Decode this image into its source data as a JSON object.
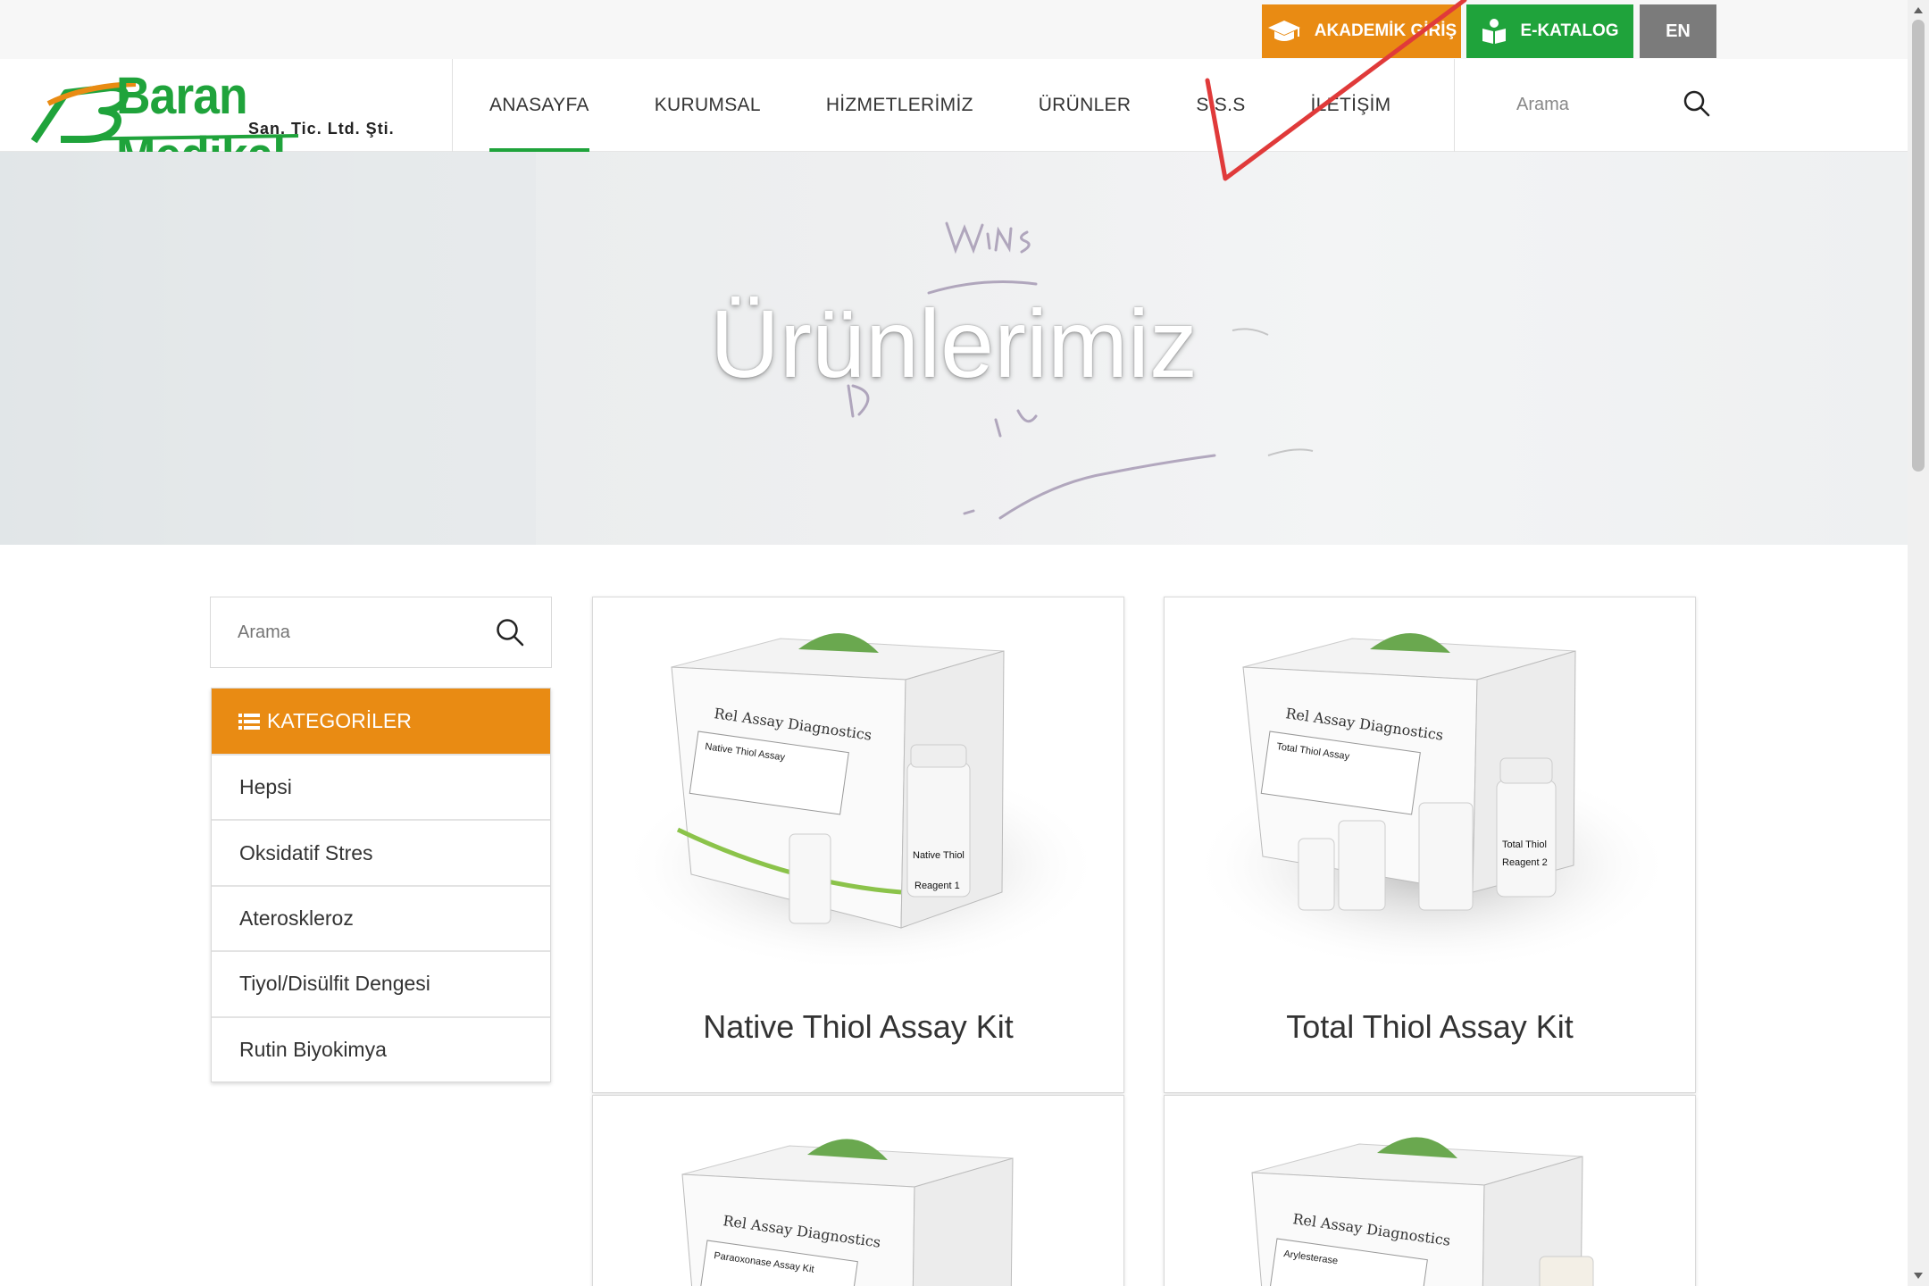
{
  "topbar": {
    "academic_label": "AKADEMİK GİRİŞ",
    "catalog_label": "E-KATALOG",
    "language_label": "EN"
  },
  "header": {
    "logo_name": "Baran Medikal",
    "logo_subtitle": "San. Tic. Ltd. Şti.",
    "nav": [
      "ANASAYFA",
      "KURUMSAL",
      "HİZMETLERİMİZ",
      "ÜRÜNLER",
      "S.S.S",
      "İLETİŞİM"
    ],
    "search_placeholder": "Arama"
  },
  "hero": {
    "title": "Ürünlerimiz"
  },
  "sidebar": {
    "search_placeholder": "Arama",
    "categories_title": "KATEGORİLER",
    "categories": [
      "Hepsi",
      "Oksidatif Stres",
      "Ateroskleroz",
      "Tiyol/Disülfit Dengesi",
      "Rutin Biyokimya"
    ]
  },
  "products": [
    {
      "name": "Native Thiol Assay Kit",
      "box_label": "Native Thiol Assay",
      "vial_label": "Native Thiol",
      "reagent": "Reagent 1"
    },
    {
      "name": "Total Thiol Assay Kit",
      "box_label": "Total Thiol Assay",
      "vial_label": "Total Thiol",
      "reagent": "Reagent 2"
    },
    {
      "name": "",
      "box_label": "Paraoxonase Assay Kit",
      "vial_label": "",
      "reagent": ""
    },
    {
      "name": "",
      "box_label": "Arylesterase",
      "vial_label": "",
      "reagent": ""
    }
  ],
  "box_brand": "Rel Assay Diagnostics",
  "colors": {
    "accent_orange": "#e98b13",
    "brand_green": "#1fa33b",
    "lang_gray": "#7b7b7b",
    "annotation_red": "#e03a3a"
  }
}
